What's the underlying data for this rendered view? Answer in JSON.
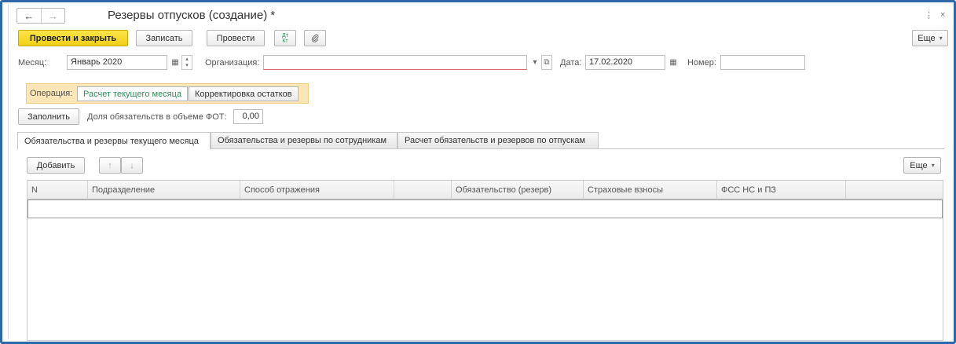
{
  "window": {
    "title": "Резервы отпусков (создание) *",
    "back_glyph": "←",
    "forward_glyph": "→",
    "menu_glyph": "⋮",
    "close_glyph": "×"
  },
  "toolbar": {
    "post_close": "Провести и закрыть",
    "save": "Записать",
    "post": "Провести",
    "dtkt_icon_text": "Дт\nКт",
    "more": "Еще"
  },
  "form": {
    "month_label": "Месяц:",
    "month_value": "Январь 2020",
    "org_label": "Организация:",
    "org_value": "",
    "date_label": "Дата:",
    "date_value": "17.02.2020",
    "number_label": "Номер:",
    "number_value": ""
  },
  "operation": {
    "label": "Операция:",
    "options": [
      "Расчет текущего месяца",
      "Корректировка остатков"
    ],
    "selected": "Расчет текущего месяца"
  },
  "fill": {
    "button": "Заполнить",
    "share_label": "Доля обязательств в объеме ФОТ:",
    "share_value": "0,00"
  },
  "tabs": [
    {
      "label": "Обязательства и резервы текущего месяца",
      "active": true
    },
    {
      "label": "Обязательства и резервы по сотрудникам",
      "active": false
    },
    {
      "label": "Расчет обязательств и резервов по отпускам",
      "active": false
    }
  ],
  "table_toolbar": {
    "add": "Добавить",
    "more": "Еще"
  },
  "table": {
    "columns": [
      "N",
      "Подразделение",
      "Способ отражения",
      "",
      "Обязательство (резерв)",
      "Страховые взносы",
      "ФСС НС и ПЗ",
      ""
    ],
    "rows": []
  },
  "colors": {
    "primary_button": "#f2cf16",
    "frame_border": "#2f68a8",
    "operation_band": "#fbe6b8",
    "selected_operation_text": "#2f8f5a"
  }
}
